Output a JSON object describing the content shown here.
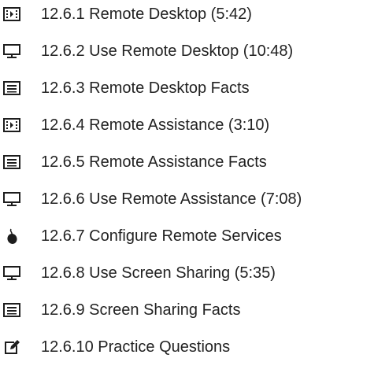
{
  "items": [
    {
      "label": "12.6.1 Remote Desktop (5:42)",
      "icon": "video-icon"
    },
    {
      "label": "12.6.2 Use Remote Desktop (10:48)",
      "icon": "monitor-icon"
    },
    {
      "label": "12.6.3 Remote Desktop Facts",
      "icon": "document-icon"
    },
    {
      "label": "12.6.4 Remote Assistance (3:10)",
      "icon": "video-icon"
    },
    {
      "label": "12.6.5 Remote Assistance Facts",
      "icon": "document-icon"
    },
    {
      "label": "12.6.6 Use Remote Assistance (7:08)",
      "icon": "monitor-icon"
    },
    {
      "label": "12.6.7 Configure Remote Services",
      "icon": "mouse-icon"
    },
    {
      "label": "12.6.8 Use Screen Sharing (5:35)",
      "icon": "monitor-icon"
    },
    {
      "label": "12.6.9 Screen Sharing Facts",
      "icon": "document-icon"
    },
    {
      "label": "12.6.10 Practice Questions",
      "icon": "practice-edit-icon"
    }
  ]
}
